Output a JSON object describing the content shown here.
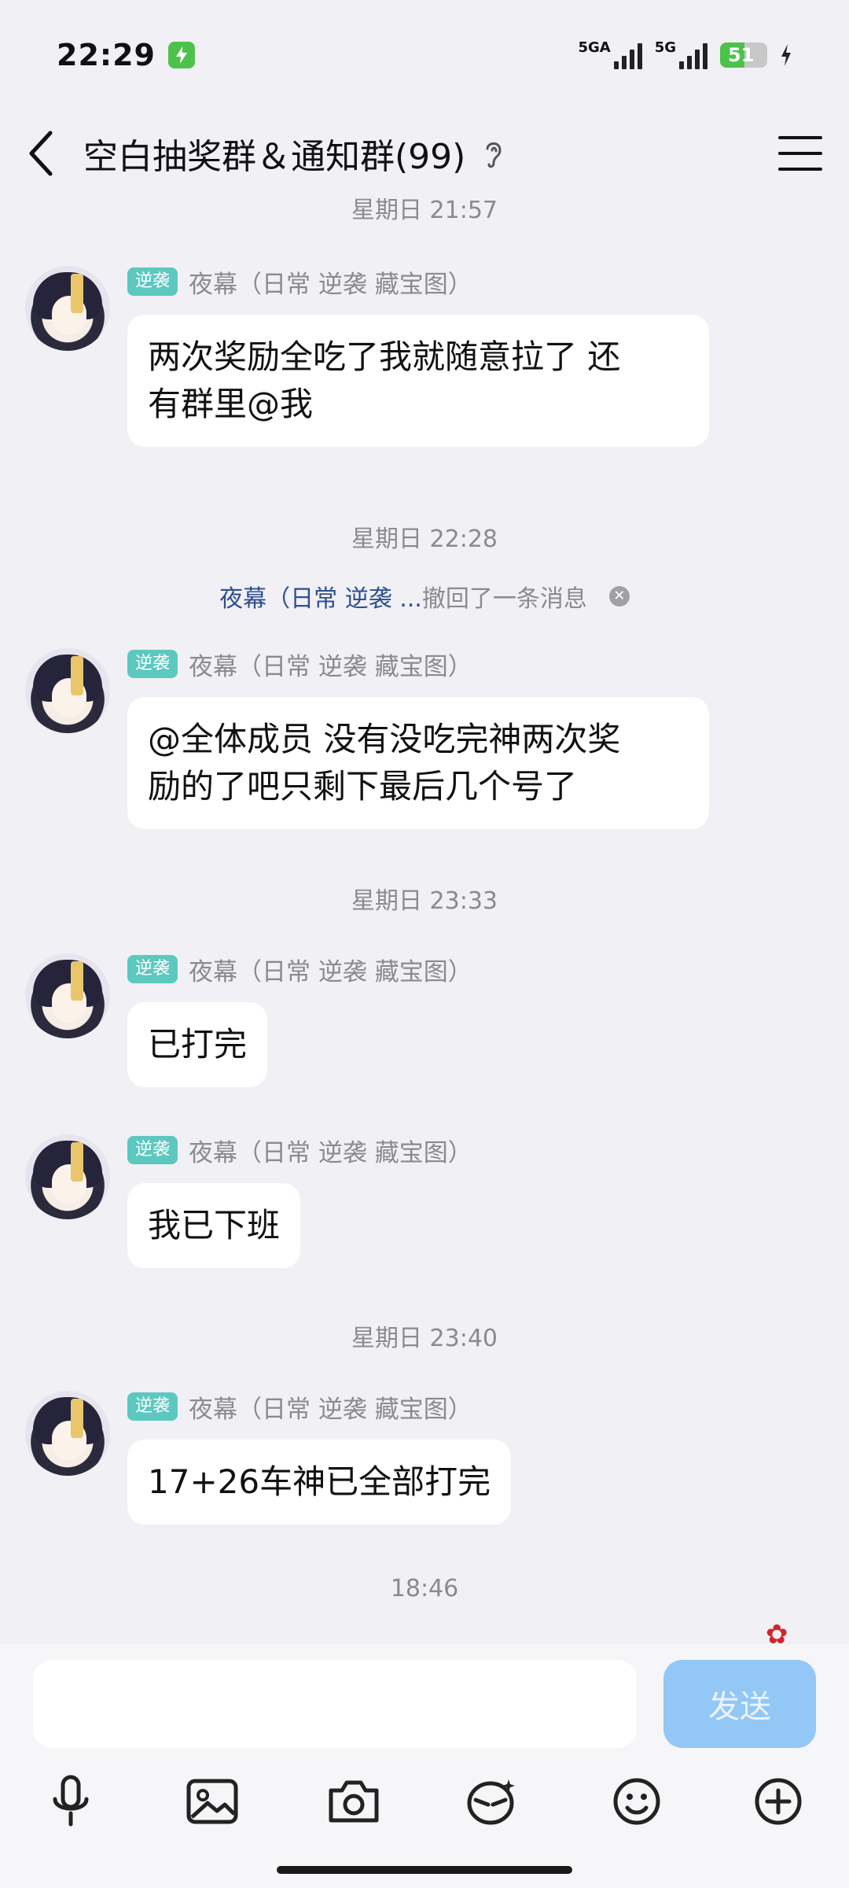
{
  "status": {
    "time": "22:29",
    "network1": "5GA",
    "network2": "5G",
    "battery": "51",
    "battery_level": 0.51
  },
  "header": {
    "title": "空白抽奖群＆通知群(99)"
  },
  "chat": {
    "cut_time": "星期日 21:57",
    "messages": [
      {
        "tag": "逆袭",
        "sender": "夜幕（日常 逆袭 藏宝图）",
        "text_line1": "两次奖励全吃了我就随意拉了 还",
        "text_line2": "有群里@我"
      },
      {
        "tag": "逆袭",
        "sender": "夜幕（日常 逆袭 藏宝图）",
        "text_line1": "@全体成员 没有没吃完神两次奖",
        "text_line2": "励的了吧只剩下最后几个号了"
      },
      {
        "tag": "逆袭",
        "sender": "夜幕（日常 逆袭 藏宝图）",
        "text": "已打完"
      },
      {
        "tag": "逆袭",
        "sender": "夜幕（日常 逆袭 藏宝图）",
        "text": "我已下班"
      },
      {
        "tag": "逆袭",
        "sender": "夜幕（日常 逆袭 藏宝图）",
        "text": "17+26车神已全部打完"
      }
    ],
    "time_labels": [
      "星期日 22:28",
      "星期日 23:33",
      "星期日 23:40",
      "18:46"
    ],
    "recall": {
      "name": "夜幕（日常 逆袭 ...",
      "text": "撤回了一条消息"
    }
  },
  "input": {
    "value": "",
    "send_label": "发送"
  },
  "icons": [
    "back-arrow-icon",
    "ear-icon",
    "menu-icon",
    "microphone-icon",
    "image-icon",
    "camera-icon",
    "sticker-icon",
    "emoji-icon",
    "plus-icon",
    "flower-icon"
  ],
  "colors": {
    "background": "#f0f0f5",
    "bubble": "#ffffff",
    "tag": "#5cc8c0",
    "send_button": "#93c7f5",
    "recall_name": "#2f4f8f"
  }
}
